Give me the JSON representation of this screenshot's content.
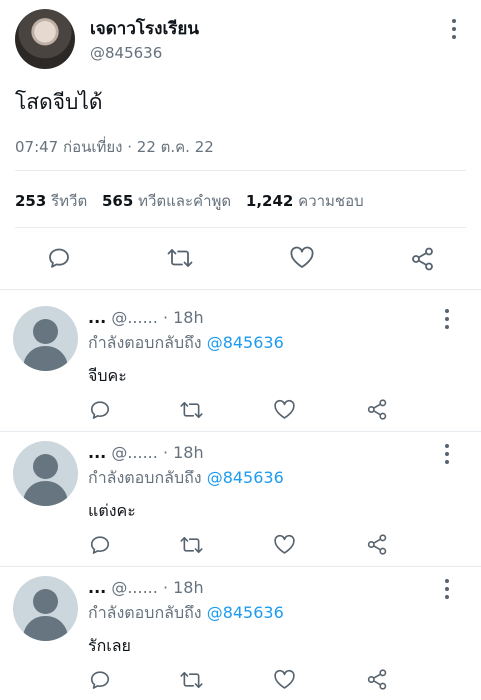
{
  "tweet": {
    "display_name": "เจดาวโรงเรียน",
    "handle": "@845636",
    "text": "โสดจีบได้",
    "meta": "07:47 ก่อนเที่ยง · 22 ต.ค. 22",
    "stats": {
      "retweets_count": "253",
      "retweets_label": "รีทวีต",
      "quotes_count": "565",
      "quotes_label": "ทวีตและคำพูด",
      "likes_count": "1,242",
      "likes_label": "ความชอบ"
    },
    "icons": [
      "reply-icon",
      "retweet-icon",
      "like-icon",
      "share-icon",
      "more-icon"
    ]
  },
  "replies": [
    {
      "name": "...",
      "handle": "@......",
      "sep": "·",
      "time": "18h",
      "replying_to_label": "กำลังตอบกลับถึง",
      "replying_to_handle": "@845636",
      "text": "จีบคะ"
    },
    {
      "name": "...",
      "handle": "@......",
      "sep": "·",
      "time": "18h",
      "replying_to_label": "กำลังตอบกลับถึง",
      "replying_to_handle": "@845636",
      "text": "แต่งคะ"
    },
    {
      "name": "...",
      "handle": "@......",
      "sep": "·",
      "time": "18h",
      "replying_to_label": "กำลังตอบกลับถึง",
      "replying_to_handle": "@845636",
      "text": "รักเลย"
    }
  ],
  "colors": {
    "link": "#1d9bf0",
    "muted": "#66727d",
    "divider": "#e6ecf0",
    "avatar_placeholder_bg": "#ccd6dd",
    "avatar_placeholder_fg": "#66757f"
  }
}
